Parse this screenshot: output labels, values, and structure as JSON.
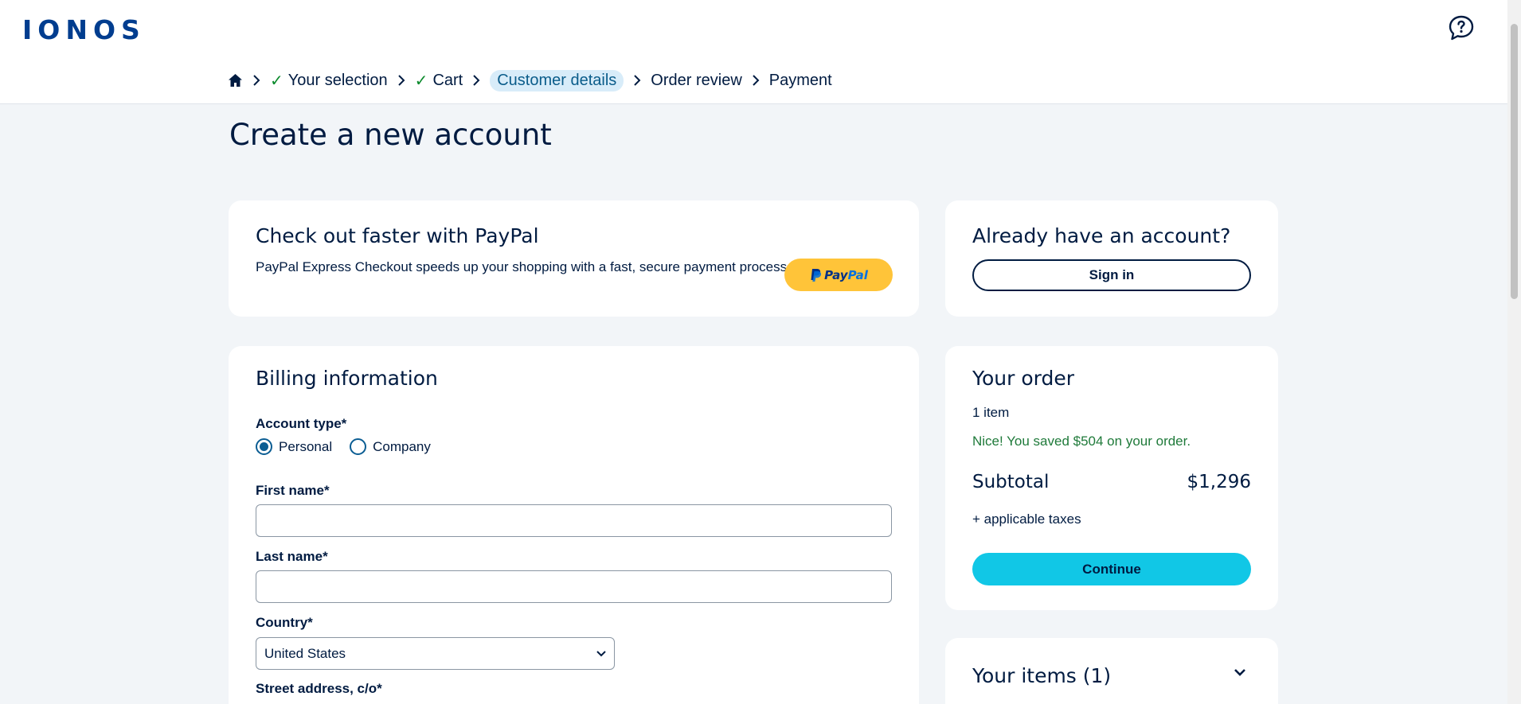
{
  "header": {
    "logo": "IONOS",
    "help_icon": "chat-help-icon"
  },
  "breadcrumb": {
    "home_icon": "home-icon",
    "step1": "Your selection",
    "step2": "Cart",
    "step3": "Customer details",
    "step4": "Order review",
    "step5": "Payment"
  },
  "page": {
    "title": "Create a new account"
  },
  "paypal": {
    "title": "Check out faster with PayPal",
    "description": "PayPal Express Checkout speeds up your shopping with a fast, secure payment process.",
    "button_pay": "Pay",
    "button_pal": "Pal"
  },
  "signin": {
    "title": "Already have an account?",
    "button": "Sign in"
  },
  "billing": {
    "title": "Billing information",
    "account_type_label": "Account type*",
    "option_personal": "Personal",
    "option_company": "Company",
    "selected_option": "Personal",
    "first_name_label": "First name*",
    "first_name_value": "",
    "last_name_label": "Last name*",
    "last_name_value": "",
    "country_label": "Country*",
    "country_value": "United States",
    "street_label": "Street address, c/o*"
  },
  "order": {
    "title": "Your order",
    "item_count": "1 item",
    "savings": "Nice! You saved $504 on your order.",
    "subtotal_label": "Subtotal",
    "subtotal_value": "$1,296",
    "taxes": "+ applicable taxes",
    "continue": "Continue"
  },
  "items": {
    "title": "Your items (1)"
  },
  "colors": {
    "accent": "#11c7e6",
    "brand": "#003d8f",
    "paypal": "#ffc439",
    "success": "#1f7a3a",
    "text": "#001b41"
  }
}
